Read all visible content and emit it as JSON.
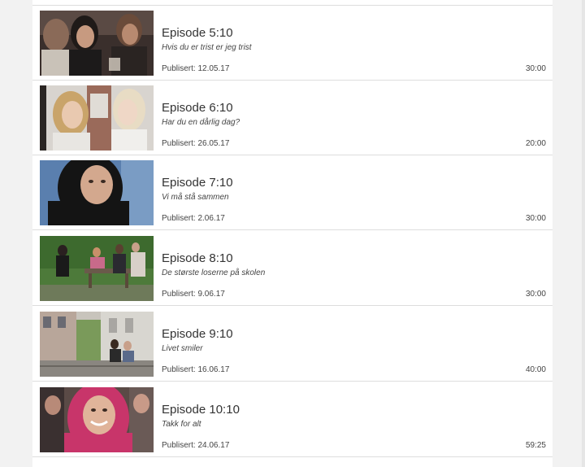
{
  "episodes": [
    {
      "title": "Episode 5:10",
      "subtitle": "Hvis du er trist er jeg trist",
      "published": "Publisert: 12.05.17",
      "duration": "30:00",
      "thumbnail": "group-of-girls-thumbnail"
    },
    {
      "title": "Episode 6:10",
      "subtitle": "Har du en dårlig dag?",
      "published": "Publisert: 26.05.17",
      "duration": "20:00",
      "thumbnail": "two-blonde-girls-thumbnail"
    },
    {
      "title": "Episode 7:10",
      "subtitle": "Vi må stå sammen",
      "published": "Publisert: 2.06.17",
      "duration": "30:00",
      "thumbnail": "girl-in-hijab-thumbnail"
    },
    {
      "title": "Episode 8:10",
      "subtitle": "De største loserne på skolen",
      "published": "Publisert: 9.06.17",
      "duration": "30:00",
      "thumbnail": "park-bench-group-thumbnail"
    },
    {
      "title": "Episode 9:10",
      "subtitle": "Livet smiler",
      "published": "Publisert: 16.06.17",
      "duration": "40:00",
      "thumbnail": "street-steps-thumbnail"
    },
    {
      "title": "Episode 10:10",
      "subtitle": "Takk for alt",
      "published": "Publisert: 24.06.17",
      "duration": "59:25",
      "thumbnail": "smiling-girl-pink-hijab-thumbnail"
    }
  ]
}
